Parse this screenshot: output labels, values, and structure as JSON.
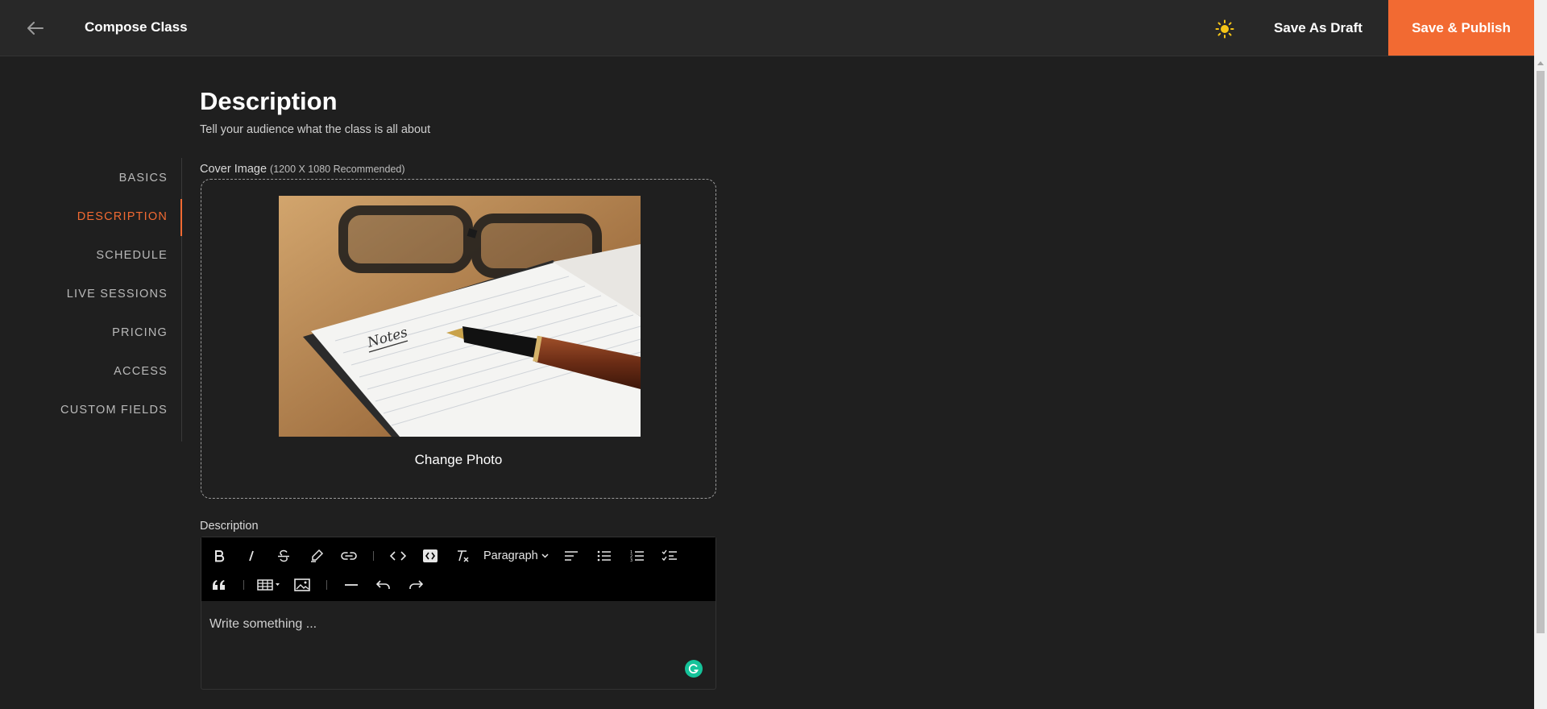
{
  "header": {
    "title": "Compose Class",
    "save_draft_label": "Save As Draft",
    "publish_label": "Save & Publish",
    "accent_color": "#f26a32",
    "icons": {
      "back": "arrow-left-icon",
      "theme": "sun-icon"
    }
  },
  "sidebar": {
    "items": [
      {
        "label": "BASICS",
        "active": false
      },
      {
        "label": "DESCRIPTION",
        "active": true
      },
      {
        "label": "SCHEDULE",
        "active": false
      },
      {
        "label": "LIVE SESSIONS",
        "active": false
      },
      {
        "label": "PRICING",
        "active": false
      },
      {
        "label": "ACCESS",
        "active": false
      },
      {
        "label": "CUSTOM FIELDS",
        "active": false
      }
    ]
  },
  "main": {
    "title": "Description",
    "subtitle": "Tell your audience what the class is all about",
    "cover": {
      "label": "Cover Image",
      "hint": "(1200 X 1080 Recommended)",
      "change_label": "Change Photo",
      "image_handwriting": "Notes"
    },
    "description": {
      "label": "Description",
      "paragraph_select": "Paragraph",
      "placeholder": "Write something ..."
    }
  }
}
